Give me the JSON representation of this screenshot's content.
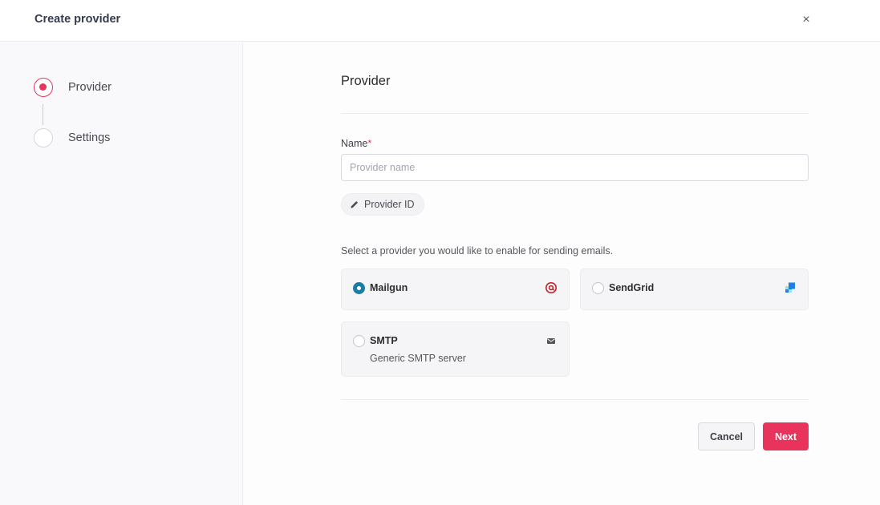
{
  "header": {
    "title": "Create provider",
    "close_icon": "×"
  },
  "steps": [
    {
      "label": "Provider",
      "active": true
    },
    {
      "label": "Settings",
      "active": false
    }
  ],
  "form": {
    "section_title": "Provider",
    "name_label": "Name",
    "required_mark": "*",
    "name_value": "",
    "name_placeholder": "Provider name",
    "provider_id_label": "Provider ID",
    "description": "Select a provider you would like to enable for sending emails."
  },
  "providers": [
    {
      "name": "Mailgun",
      "subtitle": "",
      "selected": true,
      "icon": "mailgun-icon"
    },
    {
      "name": "SendGrid",
      "subtitle": "",
      "selected": false,
      "icon": "sendgrid-icon"
    },
    {
      "name": "SMTP",
      "subtitle": "Generic SMTP server",
      "selected": false,
      "icon": "envelope-icon"
    }
  ],
  "actions": {
    "cancel_label": "Cancel",
    "next_label": "Next"
  },
  "colors": {
    "accent": "#e8335d",
    "radio_selected": "#1e7ba4",
    "sendgrid_blue": "#1a82e2",
    "mailgun_red": "#c02126"
  }
}
